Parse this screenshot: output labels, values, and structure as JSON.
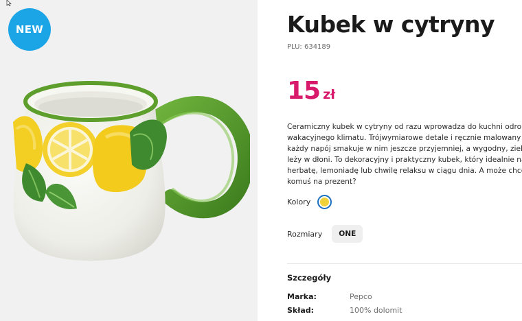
{
  "gallery": {
    "badge": "NEW",
    "image_alt": "Kubek w cytryny"
  },
  "product": {
    "title": "Kubek w cytryny",
    "plu": "PLU: 634189",
    "price_value": "15",
    "price_currency": "zł",
    "description_lines": [
      "Ceramiczny kubek w cytryny od razu wprowadza do kuchni odrobi",
      "wakacyjnego klimatu. Trójwymiarowe detale i ręcznie malowany wz",
      "każdy napój smakuje w nim jeszcze przyjemniej, a wygodny, zielony",
      "leży w dłoni. To dekoracyjny i praktyczny kubek, który idealnie nada",
      "herbatę, lemoniadę lub chwilę relaksu w ciągu dnia. A może chcesz",
      "komuś na prezent?"
    ]
  },
  "colors": {
    "label": "Kolory",
    "swatch_color": "#f1d23a",
    "selected_ring_color": "#1b6fc2"
  },
  "sizes": {
    "label": "Rozmiary",
    "options": [
      "ONE"
    ]
  },
  "details": {
    "title": "Szczegóły",
    "rows": [
      {
        "key": "Marka:",
        "value": "Pepco"
      },
      {
        "key": "Skład:",
        "value": "100% dolomit"
      }
    ]
  },
  "theme": {
    "accent": "#d81a6c",
    "badge": "#1ba4e6",
    "gallery_bg": "#f1f1f1"
  }
}
